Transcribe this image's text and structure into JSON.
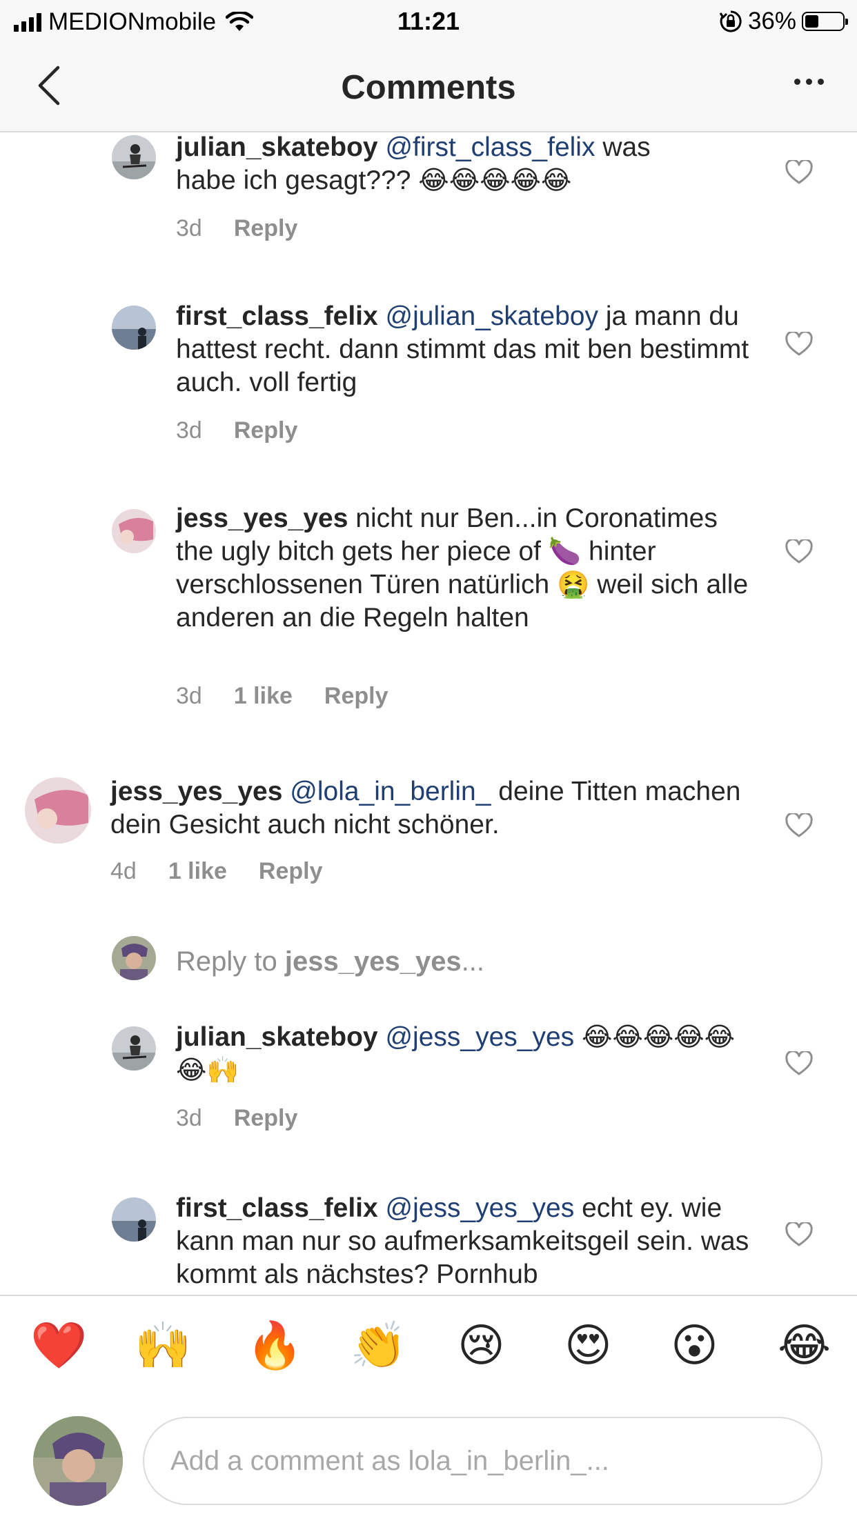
{
  "status_bar": {
    "carrier": "MEDIONmobile",
    "time": "11:21",
    "battery": "36%",
    "battery_level": 0.36
  },
  "nav": {
    "title": "Comments"
  },
  "comments": [
    {
      "user": "julian_skateboy",
      "mention": "@first_class_felix",
      "text_lines": [
        "was",
        "habe ich gesagt??? "
      ],
      "emojis": "😂😂😂😂😂",
      "time": "3d",
      "likes": "",
      "reply": "Reply"
    },
    {
      "user": "first_class_felix",
      "mention": "@julian_skateboy",
      "text": "ja mann du hattest recht. dann stimmt das mit ben bestimmt auch. voll fertig",
      "time": "3d",
      "likes": "",
      "reply": "Reply"
    },
    {
      "user": "jess_yes_yes",
      "text_a": "nicht nur Ben...in Coronatimes the ugly bitch gets her piece of ",
      "emoji_a": "🍆",
      "text_b": " hinter verschlossenen Türen natürlich ",
      "emoji_b": "🤮",
      "text_c": " weil sich alle anderen an die Regeln halten",
      "time": "3d",
      "likes": "1 like",
      "reply": "Reply"
    },
    {
      "user": "jess_yes_yes",
      "mention": "@lola_in_berlin_",
      "text": "deine Titten machen dein Gesicht auch nicht schöner.",
      "time": "4d",
      "likes": "1 like",
      "reply": "Reply"
    },
    {
      "user": "julian_skateboy",
      "mention": "@jess_yes_yes",
      "emojis": "😂😂😂😂😂😂🙌",
      "time": "3d",
      "likes": "",
      "reply": "Reply"
    },
    {
      "user": "first_class_felix",
      "mention": "@jess_yes_yes",
      "text": "echt ey. wie kann man nur so aufmerksamkeitsgeil sein. was kommt als nächstes? Pornhub"
    }
  ],
  "reply_to": {
    "prefix": "Reply to ",
    "user": "jess_yes_yes",
    "suffix": "..."
  },
  "quick_emojis": [
    "❤️",
    "🙌",
    "🔥",
    "👏",
    "😢",
    "😍",
    "😮",
    "😂"
  ],
  "compose": {
    "placeholder": "Add a comment as lola_in_berlin_..."
  },
  "colors": {
    "text": "#262626",
    "secondary": "#8e8e8e",
    "mention": "#1f3f73",
    "divider": "#dbdbdb",
    "bar_bg": "#f8f8f8"
  }
}
